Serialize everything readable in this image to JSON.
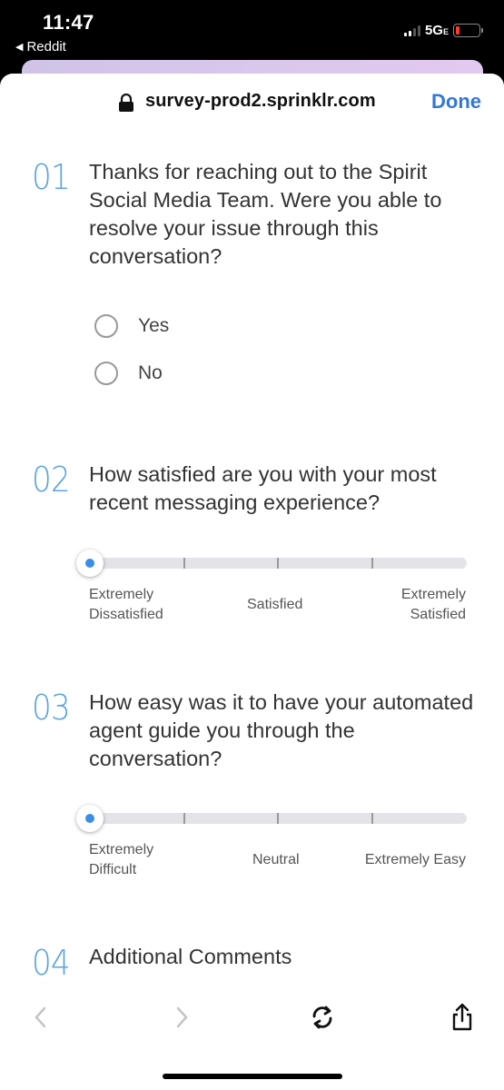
{
  "status_bar": {
    "time": "11:47",
    "back_app": "Reddit",
    "network": "5G",
    "network_suffix": "E"
  },
  "browser": {
    "url": "survey-prod2.sprinklr.com",
    "done_label": "Done"
  },
  "questions": [
    {
      "number": "01",
      "text": "Thanks for reaching out to the Spirit Social Media Team. Were you able to resolve your issue through this conversation?",
      "options": [
        "Yes",
        "No"
      ]
    },
    {
      "number": "02",
      "text": "How satisfied are you with your most recent messaging experience?",
      "labels": {
        "left_1": "Extremely",
        "left_2": "Dissatisfied",
        "middle": "Satisfied",
        "right_1": "Extremely",
        "right_2": "Satisfied"
      }
    },
    {
      "number": "03",
      "text": "How easy was it to have your automated agent guide you through the conversation?",
      "labels": {
        "left_1": "Extremely",
        "left_2": "Difficult",
        "middle": "Neutral",
        "right": "Extremely Easy"
      }
    },
    {
      "number": "04",
      "text": "Additional Comments"
    }
  ],
  "icons": {
    "lock": "lock-icon",
    "back": "chevron-left-icon",
    "forward": "chevron-right-icon",
    "reload": "reload-icon",
    "share": "share-icon"
  },
  "colors": {
    "accent": "#3478d6",
    "question_number": "#5aa3e0",
    "slider_thumb_dot": "#3a8ee6"
  }
}
